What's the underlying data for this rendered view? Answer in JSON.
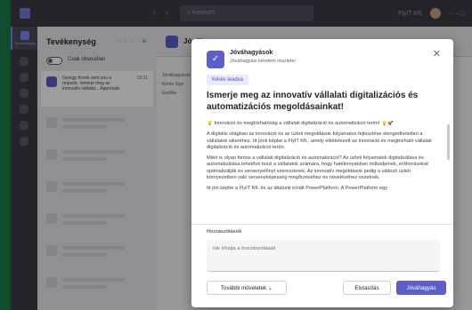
{
  "titlebar": {
    "search_placeholder": "Keresés",
    "nav_arrows": "‹ ›",
    "user_label": "FlyIT Kft."
  },
  "rail": {
    "activity_label": "Tevékenység"
  },
  "activity_panel": {
    "title": "Tevékenység",
    "tools": "··· ≡",
    "unread_toggle_label": "Csak olvasatlan",
    "feed": [
      {
        "text": "Gyorgy Korek sent you a request. Ismerje meg az innovatív vállalat... Approvals",
        "time": "19:31"
      }
    ]
  },
  "main": {
    "header_title": "Jóvál",
    "side_items": [
      "Jóváhagyások",
      "Kérés Sign",
      "Exeltáv"
    ]
  },
  "modal": {
    "app_name": "Jóváhagyások",
    "app_subtitle": "Jóváhagyási kérelem részletei",
    "status_badge": "Kérés leadva",
    "title": "Ismerje meg az innovatív vállalati digitalizációs és automatizációs megoldásainkat!",
    "paragraphs": [
      "💡 Innováció és megbízhatóság a vállalati digitalizáció és automatizáció terén! 💡🚀",
      "A digitális világban az innováció és az üzleti megoldások folyamatos fejlesztése elengedhetetlen a vállalatok sikeréhez. Itt jönk képbe a FlyIT Kft., amely elkötelezett az innováció és megbízható vállalati digitalizáció és automatizáció terén.",
      "Miért is olyan fontos a vállalati digitalizáció és automatizáció? Az üzleti folyamatok digitalizálása és automatizálása lehetővé teszi a vállalatok számára, hogy hatékonyabban működjenek, erőforrásokat optimalizálják és versenyelőnyt szerezzenek. Az innovatív megoldások pedig a változó üzleti környezetben való versenyképesség megőrzéséhez és növeléséhez vezetnek.",
      "Itt jön képbe a FlyIT Kft. és az általunk kínált PowerPlatform. A PowerPlatform egy"
    ],
    "comments_label": "Hozzászólások",
    "comments_placeholder": "Ide írhatja a hozzászólásait",
    "more_actions_label": "További műveletek",
    "reject_label": "Elutasítás",
    "approve_label": "Jóváhagyás",
    "close_symbol": "✕",
    "app_icon_glyph": "✓"
  },
  "colors": {
    "accent": "#5b5fc7",
    "frame_green": "#1b7a4a"
  }
}
